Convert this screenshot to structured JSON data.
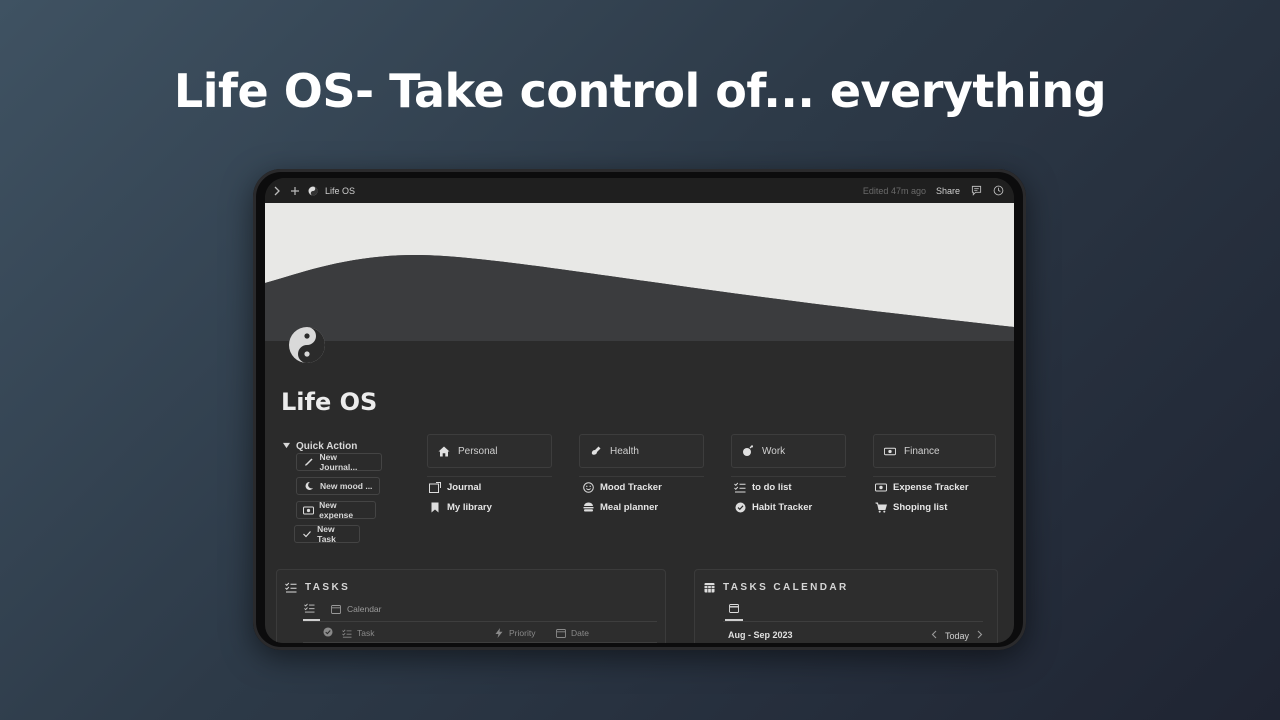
{
  "headline": "Life OS- Take control of... everything",
  "topbar": {
    "page_name": "Life OS",
    "edited": "Edited 47m ago",
    "share_label": "Share"
  },
  "page": {
    "title": "Life OS",
    "icon": "yin-yang-icon"
  },
  "quick_action": {
    "title": "Quick Action",
    "buttons": [
      {
        "label": "New Journal...",
        "icon": "pen-icon"
      },
      {
        "label": "New mood ...",
        "icon": "moon-icon"
      },
      {
        "label": "New expense",
        "icon": "money-icon"
      },
      {
        "label": "New Task",
        "icon": "check-icon"
      }
    ]
  },
  "categories": [
    {
      "label": "Personal",
      "icon": "house-icon",
      "links": [
        {
          "label": "Journal",
          "icon": "journal-icon"
        },
        {
          "label": "My library",
          "icon": "bookmark-icon"
        }
      ]
    },
    {
      "label": "Health",
      "icon": "dumbbell-icon",
      "links": [
        {
          "label": "Mood Tracker",
          "icon": "smiley-icon"
        },
        {
          "label": "Meal planner",
          "icon": "burger-icon"
        }
      ]
    },
    {
      "label": "Work",
      "icon": "brain-icon",
      "links": [
        {
          "label": "to do list",
          "icon": "checklist-icon"
        },
        {
          "label": "Habit Tracker",
          "icon": "check-circle-icon"
        }
      ]
    },
    {
      "label": "Finance",
      "icon": "money-icon",
      "links": [
        {
          "label": "Expense Tracker",
          "icon": "money-icon"
        },
        {
          "label": "Shoping list",
          "icon": "cart-icon"
        }
      ]
    }
  ],
  "tasks": {
    "title": "TASKS",
    "views": [
      "",
      "Calendar"
    ],
    "columns": [
      "Task",
      "Priority",
      "Date"
    ]
  },
  "calendar": {
    "title": "TASKS CALENDAR",
    "range": "Aug - Sep 2023",
    "today": "Today"
  },
  "colors": {
    "background_top": "#3f5262",
    "background_bottom": "#1f2432",
    "page_bg": "#2b2b2b",
    "cover_light": "#e8e8e6"
  }
}
